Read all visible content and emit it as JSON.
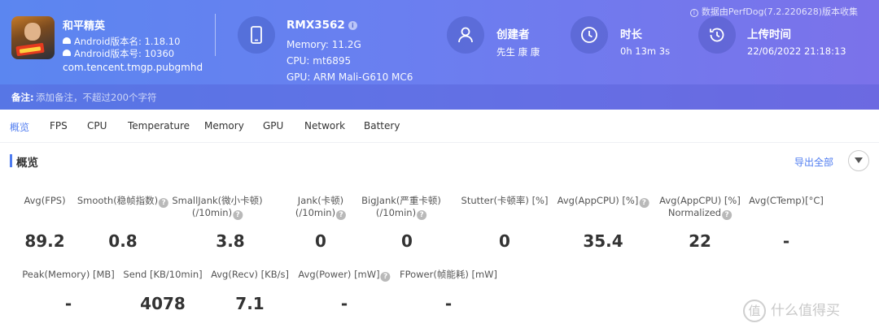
{
  "header": {
    "collect_note": "数据由PerfDog(7.2.220628)版本收集",
    "app": {
      "name": "和平精英",
      "version_name": "Android版本名: 1.18.10",
      "version_code": "Android版本号: 10360",
      "package": "com.tencent.tmgp.pubgmhd",
      "logo_text": "和平精英"
    },
    "device": {
      "name": "RMX3562",
      "memory": "Memory: 11.2G",
      "cpu": "CPU: mt6895",
      "gpu": "GPU: ARM Mali-G610 MC6"
    },
    "creator": {
      "label": "创建者",
      "value": "先生 康 康"
    },
    "duration": {
      "label": "时长",
      "value": "0h 13m 3s"
    },
    "upload": {
      "label": "上传时间",
      "value": "22/06/2022 21:18:13"
    }
  },
  "remark": {
    "label": "备注:",
    "placeholder": "添加备注，不超过200个字符"
  },
  "tabs": [
    "概览",
    "FPS",
    "CPU",
    "Temperature",
    "Memory",
    "GPU",
    "Network",
    "Battery"
  ],
  "overview": {
    "title": "概览",
    "export_label": "导出全部",
    "row1": [
      {
        "label1": "",
        "label2": "Avg(FPS)",
        "help": false,
        "value": "89.2"
      },
      {
        "label1": "",
        "label2": "Smooth(稳帧指数)",
        "help": true,
        "value": "0.8"
      },
      {
        "label1": "SmallJank(微小卡顿)",
        "label2": "(/10min)",
        "help": true,
        "value": "3.8"
      },
      {
        "label1": "Jank(卡顿)",
        "label2": "(/10min)",
        "help": true,
        "value": "0"
      },
      {
        "label1": "BigJank(严重卡顿)",
        "label2": "(/10min)",
        "help": true,
        "value": "0"
      },
      {
        "label1": "",
        "label2": "Stutter(卡顿率) [%]",
        "help": false,
        "value": "0"
      },
      {
        "label1": "",
        "label2": "Avg(AppCPU) [%]",
        "help": true,
        "value": "35.4"
      },
      {
        "label1": "Avg(AppCPU) [%]",
        "label2": "Normalized",
        "help": true,
        "value": "22"
      },
      {
        "label1": "",
        "label2": "Avg(CTemp)[°C]",
        "help": false,
        "value": "-"
      }
    ],
    "row2": [
      {
        "label": "Peak(Memory) [MB]",
        "help": false,
        "value": "-"
      },
      {
        "label": "Send [KB/10min]",
        "help": false,
        "value": "4078"
      },
      {
        "label": "Avg(Recv) [KB/s]",
        "help": false,
        "value": "7.1"
      },
      {
        "label": "Avg(Power) [mW]",
        "help": true,
        "value": "-"
      },
      {
        "label": "FPower(帧能耗) [mW]",
        "help": false,
        "value": "-"
      }
    ]
  },
  "watermark": {
    "text": "什么值得买",
    "icon": "值"
  }
}
